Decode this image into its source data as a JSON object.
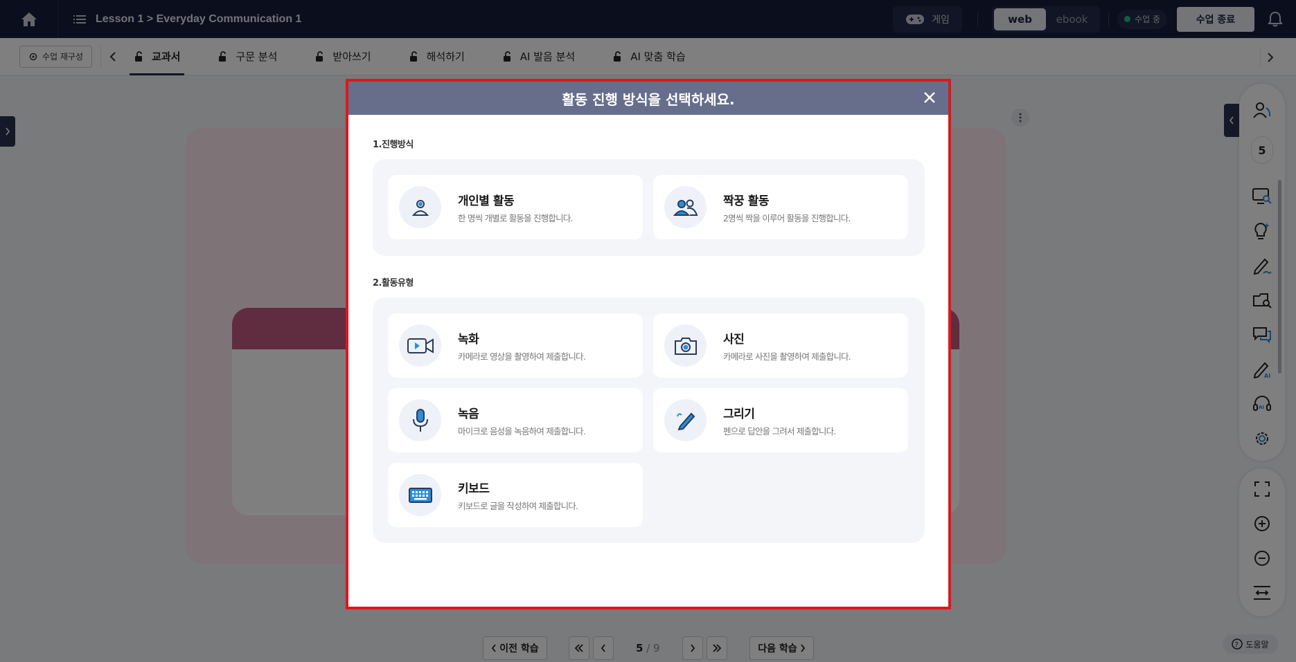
{
  "topbar": {
    "lesson_title": "Lesson 1 > Everyday Communication 1",
    "game_label": "게임",
    "view_web": "web",
    "view_ebook": "ebook",
    "status_label": "수업 중",
    "end_class_label": "수업 종료"
  },
  "tabbar": {
    "reconfigure_label": "수업 재구성",
    "tabs": [
      {
        "label": "교과서",
        "active": true
      },
      {
        "label": "구문 분석",
        "active": false
      },
      {
        "label": "받아쓰기",
        "active": false
      },
      {
        "label": "해석하기",
        "active": false
      },
      {
        "label": "AI 발음 분석",
        "active": false
      },
      {
        "label": "AI 맞춤 학습",
        "active": false
      }
    ]
  },
  "right_panel": {
    "student_count": "5"
  },
  "bottom_nav": {
    "prev_lesson": "이전 학습",
    "next_lesson": "다음 학습",
    "current_page": "5",
    "page_separator": " / ",
    "total_pages": "9",
    "help_label": "도움말"
  },
  "modal": {
    "title": "활동 진행 방식을 선택하세요.",
    "section1_label": "1.진행방식",
    "section2_label": "2.활동유형",
    "modes": [
      {
        "icon": "person-icon",
        "title": "개인별 활동",
        "desc": "한 명씩 개별로 활동을 진행합니다."
      },
      {
        "icon": "pair-icon",
        "title": "짝꿍 활동",
        "desc": "2명씩 짝을 이루어 활동을 진행합니다."
      }
    ],
    "types": [
      {
        "icon": "video-camera-icon",
        "title": "녹화",
        "desc": "카메라로 영상을 촬영하여 제출합니다."
      },
      {
        "icon": "camera-icon",
        "title": "사진",
        "desc": "카메라로 사진을 촬영하여 제출합니다."
      },
      {
        "icon": "microphone-icon",
        "title": "녹음",
        "desc": "마이크로 음성을 녹음하여 제출합니다."
      },
      {
        "icon": "pen-icon",
        "title": "그리기",
        "desc": "펜으로 답안을 그려서 제출합니다."
      },
      {
        "icon": "keyboard-icon",
        "title": "키보드",
        "desc": "키보드로 글을 작성하여 제출합니다."
      }
    ]
  },
  "colors": {
    "topbar_bg": "#161c3a",
    "modal_header": "#666e8c",
    "modal_border": "#e0161d",
    "accent_blue": "#2a8fd8"
  }
}
